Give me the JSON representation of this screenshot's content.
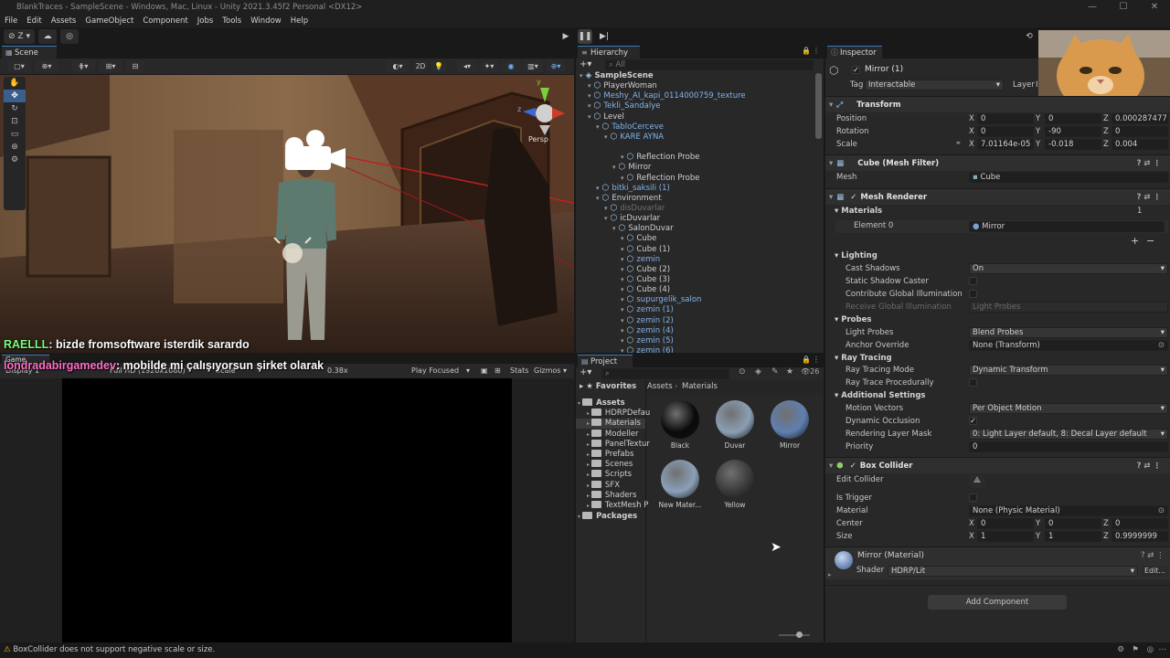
{
  "window": {
    "title": "BlankTraces - SampleScene - Windows, Mac, Linux - Unity 2021.3.45f2 Personal <DX12>"
  },
  "menu": [
    "File",
    "Edit",
    "Assets",
    "GameObject",
    "Component",
    "Jobs",
    "Tools",
    "Window",
    "Help"
  ],
  "toolbar": {
    "account_label": "Z"
  },
  "scene": {
    "tab_label": "Scene",
    "mode_2d": "2D",
    "persp_label": "Persp"
  },
  "chat": [
    {
      "user": "RAELLL",
      "message": ": bizde fromsoftware isterdik sarardo",
      "user_color": "#7CFC7C"
    },
    {
      "user": "londradabirgamedev",
      "message": ": mobilde mi çalışıyorsun şirket olarak",
      "user_color": "#ff6ec7"
    }
  ],
  "game": {
    "tab_label": "Game",
    "display": "Display 1",
    "resolution": "Full HD (1920x1080)",
    "scale_label": "Scale",
    "scale_value": "0.38x",
    "play_mode": "Play Focused",
    "stats": "Stats",
    "gizmos": "Gizmos"
  },
  "hierarchy": {
    "tab_label": "Hierarchy",
    "search_placeholder": "All",
    "rows": [
      {
        "label": "SampleScene",
        "depth": 0,
        "style": "scene"
      },
      {
        "label": "PlayerWoman",
        "depth": 1,
        "style": "normal"
      },
      {
        "label": "Meshy_AI_kapi_0114000759_texture",
        "depth": 1,
        "style": "blue"
      },
      {
        "label": "Tekli_Sandalye",
        "depth": 1,
        "style": "blue"
      },
      {
        "label": "Level",
        "depth": 1,
        "style": "normal"
      },
      {
        "label": "TabloCerceve",
        "depth": 2,
        "style": "blue"
      },
      {
        "label": "KARE AYNA",
        "depth": 3,
        "style": "blue"
      },
      {
        "label": "Mirror (1)",
        "depth": 4,
        "style": "selected"
      },
      {
        "label": "Reflection Probe",
        "depth": 5,
        "style": "normal"
      },
      {
        "label": "Mirror",
        "depth": 4,
        "style": "normal"
      },
      {
        "label": "Reflection Probe",
        "depth": 5,
        "style": "normal"
      },
      {
        "label": "bitki_saksili (1)",
        "depth": 2,
        "style": "blue"
      },
      {
        "label": "Environment",
        "depth": 2,
        "style": "normal"
      },
      {
        "label": "disDuvarlar",
        "depth": 3,
        "style": "dim"
      },
      {
        "label": "icDuvarlar",
        "depth": 3,
        "style": "normal"
      },
      {
        "label": "SalonDuvar",
        "depth": 4,
        "style": "normal"
      },
      {
        "label": "Cube",
        "depth": 5,
        "style": "normal"
      },
      {
        "label": "Cube (1)",
        "depth": 5,
        "style": "normal"
      },
      {
        "label": "zemin",
        "depth": 5,
        "style": "blue"
      },
      {
        "label": "Cube (2)",
        "depth": 5,
        "style": "normal"
      },
      {
        "label": "Cube (3)",
        "depth": 5,
        "style": "normal"
      },
      {
        "label": "Cube (4)",
        "depth": 5,
        "style": "normal"
      },
      {
        "label": "supurgelik_salon",
        "depth": 5,
        "style": "blue"
      },
      {
        "label": "zemin (1)",
        "depth": 5,
        "style": "blue"
      },
      {
        "label": "zemin (2)",
        "depth": 5,
        "style": "blue"
      },
      {
        "label": "zemin (4)",
        "depth": 5,
        "style": "blue"
      },
      {
        "label": "zemin (5)",
        "depth": 5,
        "style": "blue"
      },
      {
        "label": "zemin (6)",
        "depth": 5,
        "style": "blue"
      }
    ]
  },
  "project": {
    "tab_label": "Project",
    "badge_count": "26",
    "favorites": "Favorites",
    "tree": [
      {
        "label": "Assets",
        "depth": 0,
        "bold": true
      },
      {
        "label": "HDRPDefau",
        "depth": 1
      },
      {
        "label": "Materials",
        "depth": 1,
        "selected": true
      },
      {
        "label": "Modeller",
        "depth": 1
      },
      {
        "label": "PanelTextur",
        "depth": 1
      },
      {
        "label": "Prefabs",
        "depth": 1
      },
      {
        "label": "Scenes",
        "depth": 1
      },
      {
        "label": "Scripts",
        "depth": 1
      },
      {
        "label": "SFX",
        "depth": 1
      },
      {
        "label": "Shaders",
        "depth": 1
      },
      {
        "label": "TextMesh P",
        "depth": 1
      },
      {
        "label": "Packages",
        "depth": 0,
        "bold": true
      }
    ],
    "breadcrumb": [
      "Assets",
      "Materials"
    ],
    "materials": [
      {
        "label": "Black",
        "color": "#0a0a0a"
      },
      {
        "label": "Duvar",
        "color": "#8a9fb4"
      },
      {
        "label": "Mirror",
        "color": "#5f7fb0"
      },
      {
        "label": "New Mater...",
        "color": "#8aa0b8"
      },
      {
        "label": "Yellow",
        "color": "#3a3a3a"
      }
    ]
  },
  "inspector": {
    "tab_label": "Inspector",
    "object_name": "Mirror (1)",
    "tag_label": "Tag",
    "tag_value": "Interactable",
    "layer_label": "Layer",
    "layer_value": "I",
    "transform": {
      "title": "Transform",
      "position": {
        "label": "Position",
        "x": "0",
        "y": "0",
        "z": "0.0002874779"
      },
      "rotation": {
        "label": "Rotation",
        "x": "0",
        "y": "-90",
        "z": "0"
      },
      "scale": {
        "label": "Scale",
        "x": "7.01164e-05",
        "y": "-0.018",
        "z": "0.004"
      }
    },
    "mesh_filter": {
      "title": "Cube (Mesh Filter)",
      "mesh_label": "Mesh",
      "mesh_value": "Cube"
    },
    "mesh_renderer": {
      "title": "Mesh Renderer",
      "materials_label": "Materials",
      "materials_count": "1",
      "element0_label": "Element 0",
      "element0_value": "Mirror",
      "lighting": "Lighting",
      "cast_shadows_label": "Cast Shadows",
      "cast_shadows_value": "On",
      "static_shadow_label": "Static Shadow Caster",
      "contribute_gi_label": "Contribute Global Illumination",
      "receive_gi_label": "Receive Global Illumination",
      "receive_gi_value": "Light Probes",
      "probes": "Probes",
      "light_probes_label": "Light Probes",
      "light_probes_value": "Blend Probes",
      "anchor_label": "Anchor Override",
      "anchor_value": "None (Transform)",
      "ray_tracing": "Ray Tracing",
      "rt_mode_label": "Ray Tracing Mode",
      "rt_mode_value": "Dynamic Transform",
      "rt_proc_label": "Ray Trace Procedurally",
      "additional": "Additional Settings",
      "motion_label": "Motion Vectors",
      "motion_value": "Per Object Motion",
      "occlusion_label": "Dynamic Occlusion",
      "mask_label": "Rendering Layer Mask",
      "mask_value": "0: Light Layer default, 8: Decal Layer default",
      "priority_label": "Priority",
      "priority_value": "0"
    },
    "box_collider": {
      "title": "Box Collider",
      "edit_label": "Edit Collider",
      "trigger_label": "Is Trigger",
      "material_label": "Material",
      "material_value": "None (Physic Material)",
      "center": {
        "label": "Center",
        "x": "0",
        "y": "0",
        "z": "0"
      },
      "size": {
        "label": "Size",
        "x": "1",
        "y": "1",
        "z": "0.9999999"
      }
    },
    "material": {
      "title": "Mirror (Material)",
      "shader_label": "Shader",
      "shader_value": "HDRP/Lit",
      "edit_label": "Edit..."
    },
    "add_component": "Add Component"
  },
  "status": {
    "message": "BoxCollider does not support negative scale or size."
  }
}
